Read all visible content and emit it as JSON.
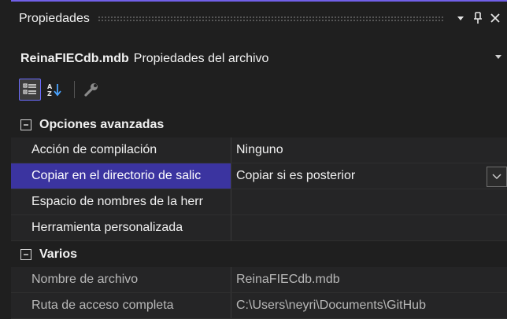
{
  "panel": {
    "title": "Propiedades",
    "pin_glyph": "▾",
    "autohide_glyph": "⊥",
    "close_glyph": "✕"
  },
  "object": {
    "name": "ReinaFIECdb.mdb",
    "description": "Propiedades del archivo",
    "dropdown_glyph": "▾"
  },
  "toolbar": {
    "items": [
      {
        "icon": "categorized-view-icon",
        "active": true
      },
      {
        "icon": "alphabetical-sort-icon",
        "active": false
      },
      {
        "icon": "property-pages-wrench-icon",
        "active": false
      }
    ]
  },
  "grid": {
    "categories": [
      {
        "label": "Opciones avanzadas",
        "toggle": "⊟",
        "properties": [
          {
            "name": "Acción de compilación",
            "value": "Ninguno"
          },
          {
            "name": "Copiar en el directorio de salic",
            "value": "Copiar si es posterior",
            "selected": true
          },
          {
            "name": "Espacio de nombres de la herr",
            "value": ""
          },
          {
            "name": "Herramienta personalizada",
            "value": ""
          }
        ]
      },
      {
        "label": "Varios",
        "toggle": "⊟",
        "properties": [
          {
            "name": "Nombre de archivo",
            "value": "ReinaFIECdb.mdb"
          },
          {
            "name": "Ruta de acceso completa",
            "value": "C:\\Users\\neyri\\Documents\\GitHub"
          }
        ]
      }
    ]
  },
  "colors": {
    "accent": "#7160e8",
    "selection": "#3b34a0",
    "background": "#1f1f1f",
    "row_background": "#252526"
  }
}
